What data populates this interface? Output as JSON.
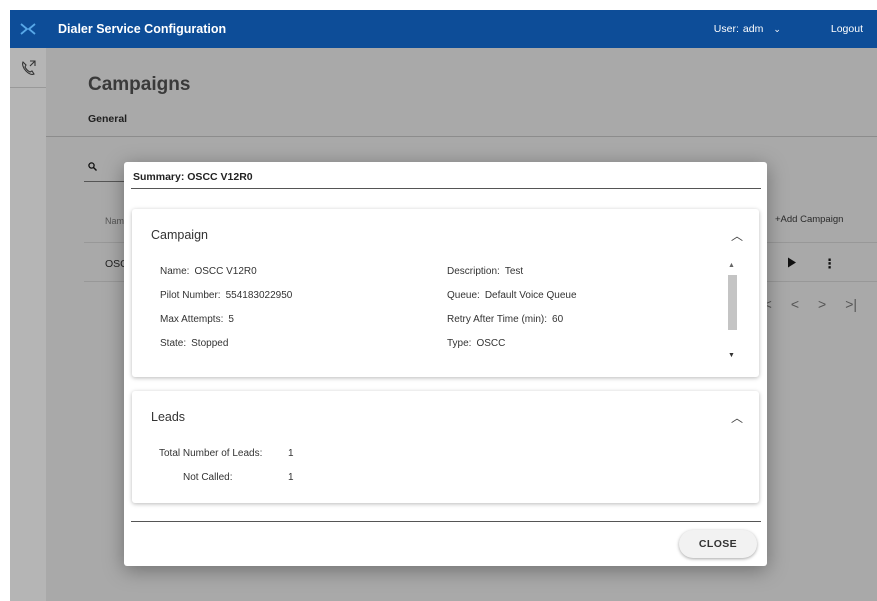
{
  "header": {
    "title": "Dialer Service Configuration",
    "user_label": "User:",
    "user_name": "adm",
    "logout_label": "Logout"
  },
  "page": {
    "title": "Campaigns",
    "tab_general": "General",
    "table": {
      "name_col": "Nam",
      "row_name": "OSC",
      "add_campaign": "+Add Campaign"
    },
    "pager": {
      "first": "|<",
      "prev": "<",
      "next": ">",
      "last": ">|"
    }
  },
  "modal": {
    "title": "Summary: OSCC V12R0",
    "campaign_panel": {
      "title": "Campaign",
      "fields": [
        {
          "label": "Name:",
          "value": "OSCC V12R0"
        },
        {
          "label": "Description:",
          "value": "Test"
        },
        {
          "label": "Pilot Number:",
          "value": "554183022950"
        },
        {
          "label": "Queue:",
          "value": "Default Voice Queue"
        },
        {
          "label": "Max Attempts:",
          "value": "5"
        },
        {
          "label": "Retry After Time (min):",
          "value": "60"
        },
        {
          "label": "State:",
          "value": "Stopped"
        },
        {
          "label": "Type:",
          "value": "OSCC"
        }
      ]
    },
    "leads_panel": {
      "title": "Leads",
      "total_label": "Total Number of Leads:",
      "total_value": "1",
      "not_called_label": "Not Called:",
      "not_called_value": "1"
    },
    "close_label": "CLOSE"
  },
  "colors": {
    "header_bg": "#0d4d98",
    "overlay_bg": "#a9a9a9"
  }
}
